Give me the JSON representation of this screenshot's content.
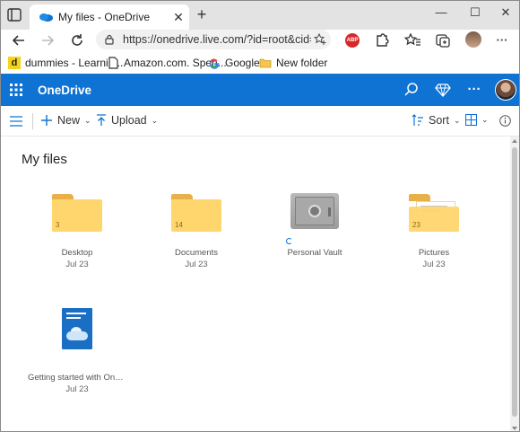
{
  "browser": {
    "tab": {
      "title": "My files - OneDrive",
      "close_label": "✕"
    },
    "new_tab_label": "+",
    "window_controls": {
      "minimize": "—",
      "maximize": "☐",
      "close": "✕"
    },
    "address": {
      "url": "https://onedrive.live.com/?id=root&cid=8..."
    },
    "extension_abp_label": "ABP",
    "more_label": "···"
  },
  "bookmarks": [
    {
      "label": "dummies - Learnin...",
      "icon": "dummies-d-icon"
    },
    {
      "label": "Amazon.com. Spen...",
      "icon": "page-icon"
    },
    {
      "label": "Google",
      "icon": "google-g-icon"
    },
    {
      "label": "New folder",
      "icon": "folder-icon"
    }
  ],
  "onedrive": {
    "brand": "OneDrive",
    "header_icons": [
      "search-icon",
      "premium-diamond-icon",
      "more-icon",
      "account-avatar"
    ],
    "more_label": "···"
  },
  "commands": {
    "new_label": "New",
    "upload_label": "Upload",
    "sort_label": "Sort"
  },
  "page": {
    "title": "My files"
  },
  "items": [
    {
      "name": "Desktop",
      "date": "Jul 23",
      "type": "folder",
      "count": "3"
    },
    {
      "name": "Documents",
      "date": "Jul 23",
      "type": "folder",
      "count": "14"
    },
    {
      "name": "Personal Vault",
      "date": "",
      "type": "vault"
    },
    {
      "name": "Pictures",
      "date": "Jul 23",
      "type": "folder",
      "count": "23"
    },
    {
      "name": "Getting started with OneD...",
      "date": "Jul 23",
      "type": "document"
    }
  ],
  "colors": {
    "onedrive_blue": "#0f73d4",
    "folder_yellow": "#ffd66e",
    "tabstrip_gray": "#e3e3e3"
  }
}
